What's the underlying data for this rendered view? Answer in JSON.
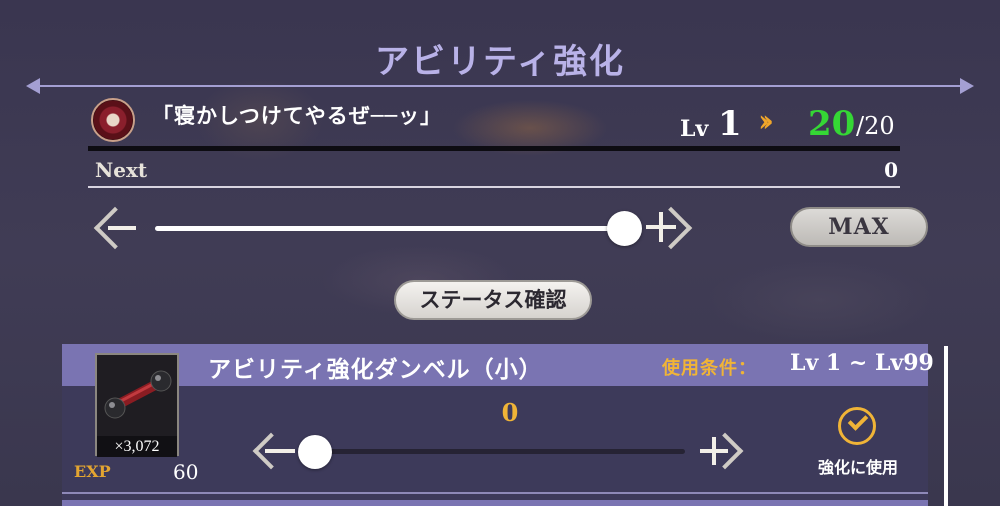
{
  "header": {
    "title": "アビリティ強化"
  },
  "ability": {
    "icon": "ability-emblem-icon",
    "name": "「寝かしつけてやるぜ──ッ」",
    "lv_label": "Lv",
    "current_level": "1",
    "arrow": "»",
    "new_level": "20",
    "max_level": "/20",
    "next_label": "Next",
    "next_value": "0"
  },
  "main_slider": {
    "value_fraction": 1.0,
    "max_button": "MAX"
  },
  "status_button": "ステータス確認",
  "item": {
    "name": "アビリティ強化ダンベル（小）",
    "condition_label": "使用条件：",
    "condition_value": "Lv 1 ~ Lv99",
    "count": "×3,072",
    "exp_label": "EXP",
    "exp_value": "60",
    "quantity": "0",
    "use_label": "強化に使用",
    "slider_fraction": 0.0
  },
  "colors": {
    "title": "#b9b2e8",
    "accent_gold": "#f0b437",
    "new_level_green": "#35d735",
    "panel_header": "#7a74b2"
  }
}
